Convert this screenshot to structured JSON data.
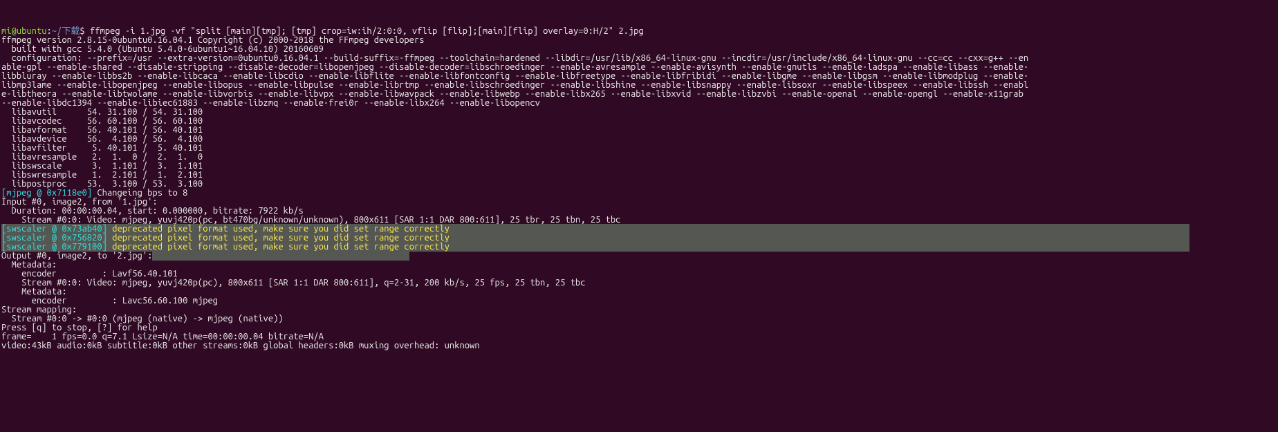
{
  "prompt": {
    "user_host": "mi@ubuntu",
    "colon": ":",
    "path": "~/下载",
    "dollar": "$ ",
    "command": "ffmpeg -i 1.jpg -vf \"split [main][tmp]; [tmp] crop=iw:ih/2:0:0, vflip [flip];[main][flip] overlay=0:H/2\" 2.jpg"
  },
  "l01": "ffmpeg version 2.8.15-0ubuntu0.16.04.1 Copyright (c) 2000-2018 the FFmpeg developers",
  "l02": "  built with gcc 5.4.0 (Ubuntu 5.4.0-6ubuntu1~16.04.10) 20160609",
  "l03": "  configuration: --prefix=/usr --extra-version=0ubuntu0.16.04.1 --build-suffix=-ffmpeg --toolchain=hardened --libdir=/usr/lib/x86_64-linux-gnu --incdir=/usr/include/x86_64-linux-gnu --cc=cc --cxx=g++ --en",
  "l04": "able-gpl --enable-shared --disable-stripping --disable-decoder=libopenjpeg --disable-decoder=libschroedinger --enable-avresample --enable-avisynth --enable-gnutls --enable-ladspa --enable-libass --enable-",
  "l05": "libbluray --enable-libbs2b --enable-libcaca --enable-libcdio --enable-libflite --enable-libfontconfig --enable-libfreetype --enable-libfribidi --enable-libgme --enable-libgsm --enable-libmodplug --enable-",
  "l06": "libmp3lame --enable-libopenjpeg --enable-libopus --enable-libpulse --enable-librtmp --enable-libschroedinger --enable-libshine --enable-libsnappy --enable-libsoxr --enable-libspeex --enable-libssh --enabl",
  "l07": "e-libtheora --enable-libtwolame --enable-libvorbis --enable-libvpx --enable-libwavpack --enable-libwebp --enable-libx265 --enable-libxvid --enable-libzvbi --enable-openal --enable-opengl --enable-x11grab ",
  "l08": "--enable-libdc1394 --enable-libiec61883 --enable-libzmq --enable-frei0r --enable-libx264 --enable-libopencv",
  "l09": "  libavutil      54. 31.100 / 54. 31.100",
  "l10": "  libavcodec     56. 60.100 / 56. 60.100",
  "l11": "  libavformat    56. 40.101 / 56. 40.101",
  "l12": "  libavdevice    56.  4.100 / 56.  4.100",
  "l13": "  libavfilter     5. 40.101 /  5. 40.101",
  "l14": "  libavresample   2.  1.  0 /  2.  1.  0",
  "l15": "  libswscale      3.  1.101 /  3.  1.101",
  "l16": "  libswresample   1.  2.101 /  1.  2.101",
  "l17": "  libpostproc    53.  3.100 / 53.  3.100",
  "mjpeg": {
    "tag": "[mjpeg @ 0x7118e0] ",
    "msg": "Changeing bps to 8"
  },
  "l19": "Input #0, image2, from '1.jpg':",
  "l20": "  Duration: 00:00:00.04, start: 0.000000, bitrate: 7922 kb/s",
  "l21": "    Stream #0:0: Video: mjpeg, yuvj420p(pc, bt470bg/unknown/unknown), 800x611 [SAR 1:1 DAR 800:611], 25 tbr, 25 tbn, 25 tbc",
  "sw1": {
    "tag": "[swscaler @ 0x73ab40] ",
    "msg": "deprecated pixel format used, make sure you did set range correctly",
    "pad": "                                                                                                                                                   "
  },
  "sw2": {
    "tag": "[swscaler @ 0x756820] ",
    "msg": "deprecated pixel format used, make sure you did set range correctly",
    "pad": "                                                                                                                                                   "
  },
  "sw3": {
    "tag": "[swscaler @ 0x779100] ",
    "msg": "deprecated pixel format used, make sure you did set range correctly",
    "pad": "                                                                                                                                                   "
  },
  "l25a": "Output #0, image2, to '2.jpg':",
  "l25b": "                                                   ",
  "l26": "  Metadata:",
  "l27": "    encoder         : Lavf56.40.101",
  "l28": "    Stream #0:0: Video: mjpeg, yuvj420p(pc), 800x611 [SAR 1:1 DAR 800:611], q=2-31, 200 kb/s, 25 fps, 25 tbn, 25 tbc",
  "l29": "    Metadata:",
  "l30": "      encoder         : Lavc56.60.100 mjpeg",
  "l31": "Stream mapping:",
  "l32": "  Stream #0:0 -> #0:0 (mjpeg (native) -> mjpeg (native))",
  "l33": "Press [q] to stop, [?] for help",
  "l34": "frame=    1 fps=0.0 q=7.1 Lsize=N/A time=00:00:00.04 bitrate=N/A    ",
  "l35": "video:43kB audio:0kB subtitle:0kB other streams:0kB global headers:0kB muxing overhead: unknown"
}
